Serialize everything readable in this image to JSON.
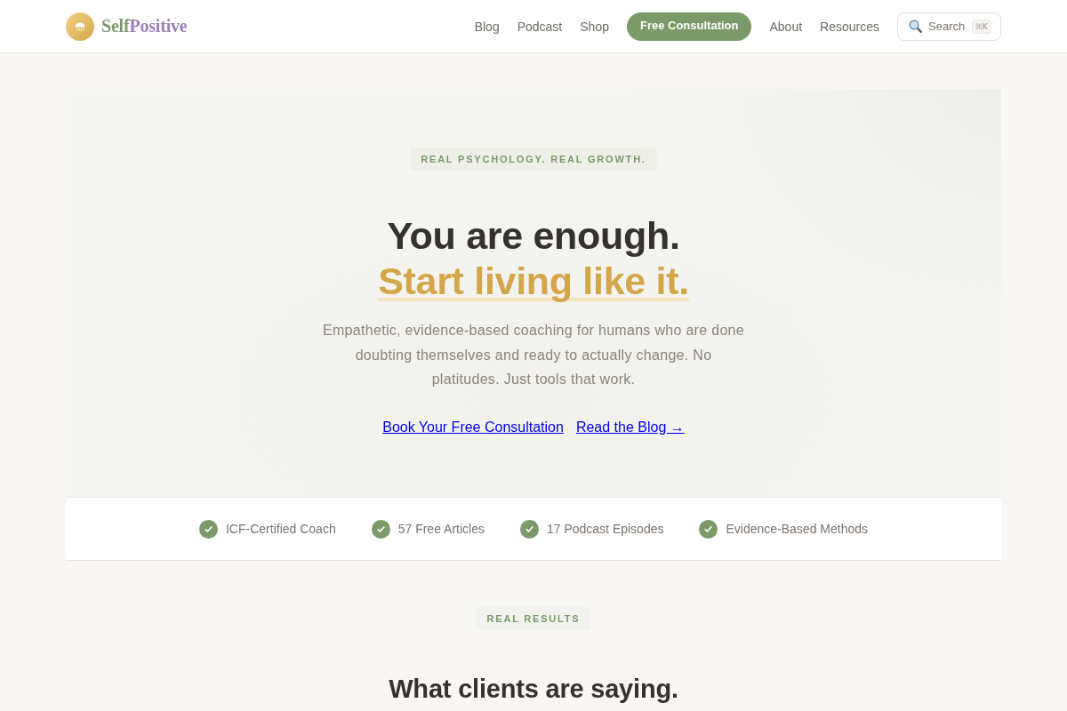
{
  "header": {
    "brand": {
      "parts": [
        "Self",
        "Positive"
      ]
    },
    "nav": [
      {
        "label": "Blog",
        "kind": "link"
      },
      {
        "label": "Podcast",
        "kind": "link"
      },
      {
        "label": "Shop",
        "kind": "link"
      },
      {
        "label": "Free Consultation",
        "kind": "button"
      },
      {
        "label": "About",
        "kind": "link"
      },
      {
        "label": "Resources",
        "kind": "link"
      }
    ],
    "search": {
      "label": "Search",
      "shortcut": "⌘K"
    }
  },
  "hero": {
    "eyebrow": "REAL PSYCHOLOGY. REAL GROWTH.",
    "title": "You are enough.",
    "highlight": "Start living like it.",
    "description": "Empathetic, evidence-based coaching for humans who are done doubting themselves and ready to actually change. No platitudes. Just tools that work.",
    "links": [
      {
        "label": "Book Your Free Consultation"
      },
      {
        "label": "Read the Blog →"
      }
    ]
  },
  "highlights": [
    {
      "label": "ICF-Certified Coach"
    },
    {
      "label": "57 Free Articles"
    },
    {
      "label": "17 Podcast Episodes"
    },
    {
      "label": "Evidence-Based Methods"
    }
  ],
  "testimonials": {
    "eyebrow": "REAL RESULTS",
    "title": "What clients are saying."
  }
}
